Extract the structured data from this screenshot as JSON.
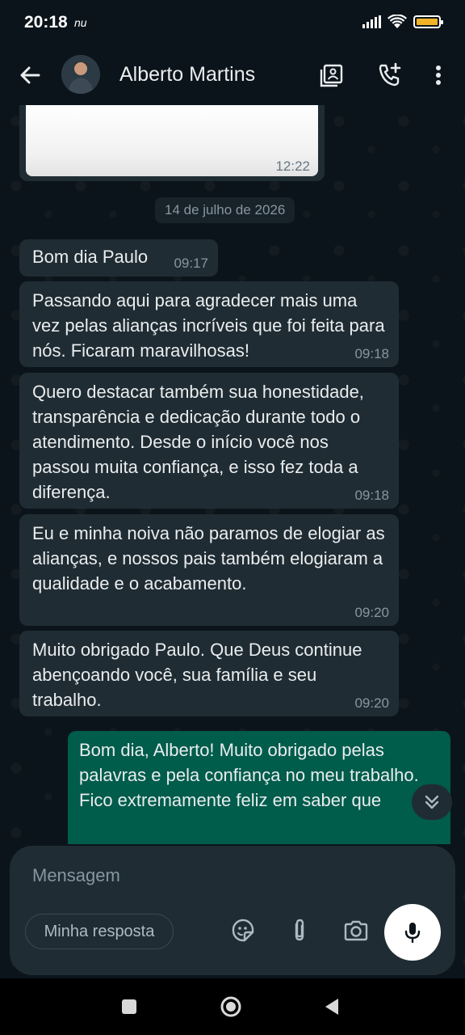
{
  "status_bar": {
    "time": "20:18",
    "carrier": "nu",
    "battery_level": 0.85,
    "battery_color": "#f1b328"
  },
  "header": {
    "contact_name": "Alberto Martins",
    "icons": [
      "back-arrow-icon",
      "contacts-book-icon",
      "add-call-icon",
      "more-vertical-icon"
    ]
  },
  "chat": {
    "image_message": {
      "time": "12:22"
    },
    "date_divider": "14 de julho de 2026",
    "messages": [
      {
        "direction": "in",
        "text": "Bom dia Paulo",
        "time": "09:17"
      },
      {
        "direction": "in",
        "text": "Passando aqui para agradecer mais uma vez pelas alianças incríveis que foi feita para nós. Ficaram maravilhosas!",
        "time": "09:18"
      },
      {
        "direction": "in",
        "text": "Quero destacar também sua honestidade, transparência e dedicação durante todo o atendimento. Desde o início você nos passou muita confiança, e isso fez toda a diferença.",
        "time": "09:18"
      },
      {
        "direction": "in",
        "text": "Eu e minha noiva não paramos de elogiar as alianças, e nossos pais também elogiaram a qualidade e o acabamento.",
        "time": "09:20"
      },
      {
        "direction": "in",
        "text": "Muito obrigado Paulo. Que Deus continue abençoando você, sua família e seu trabalho.",
        "time": "09:20"
      },
      {
        "direction": "out",
        "text": "Bom dia, Alberto! Muito obrigado pelas palavras e pela confiança no meu trabalho.\nFico extremamente feliz em saber que"
      }
    ]
  },
  "composer": {
    "placeholder": "Mensagem",
    "reply_chip": "Minha resposta",
    "icons": [
      "sticker-icon",
      "attach-icon",
      "camera-icon",
      "mic-icon"
    ]
  },
  "colors": {
    "bubble_in": "#202c33",
    "bubble_out": "#005c4b",
    "background": "#0b141a"
  }
}
